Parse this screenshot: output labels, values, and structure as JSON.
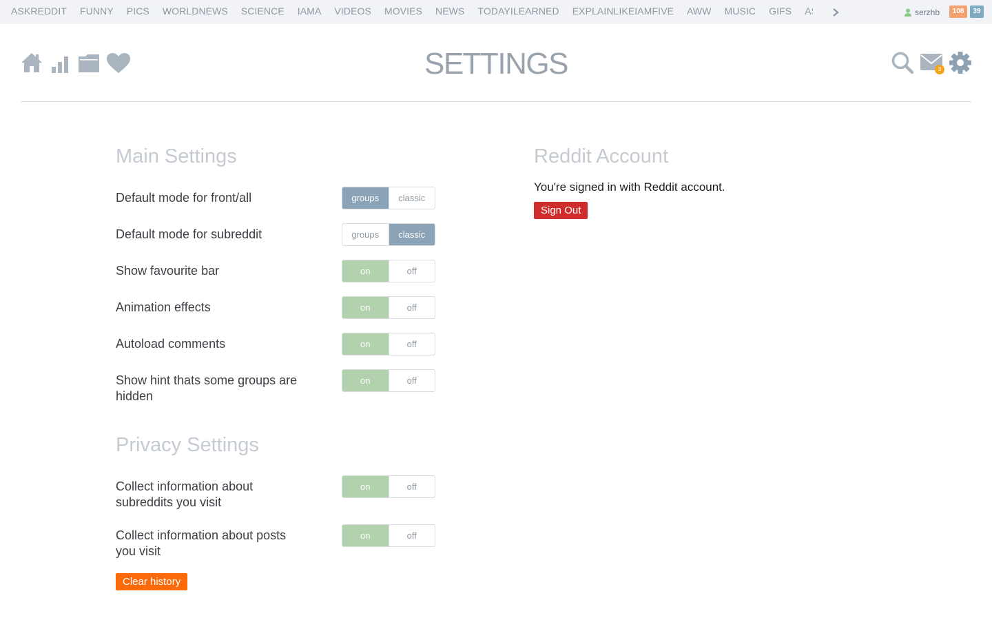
{
  "topbar": {
    "subreddits": [
      "ASKREDDIT",
      "FUNNY",
      "PICS",
      "WORLDNEWS",
      "SCIENCE",
      "IAMA",
      "VIDEOS",
      "MOVIES",
      "NEWS",
      "TODAYILEARNED",
      "EXPLAINLIKEIAMFIVE",
      "AWW",
      "MUSIC",
      "GIFS",
      "ASKSCIENCE"
    ],
    "username": "serzhb",
    "karma": "108",
    "comment_karma": "39"
  },
  "header": {
    "title": "SETTINGS",
    "mail_count": "3",
    "icons": [
      "home-icon",
      "stats-icon",
      "folder-icon",
      "heart-icon",
      "search-icon",
      "mail-icon",
      "gear-icon"
    ]
  },
  "main_settings": {
    "title": "Main Settings",
    "rows": [
      {
        "label": "Default mode for front/all",
        "options": [
          "groups",
          "classic"
        ],
        "selected": 0,
        "style": "blue"
      },
      {
        "label": "Default mode for subreddit",
        "options": [
          "groups",
          "classic"
        ],
        "selected": 1,
        "style": "blue"
      },
      {
        "label": "Show favourite bar",
        "options": [
          "on",
          "off"
        ],
        "selected": 0,
        "style": "green"
      },
      {
        "label": "Animation effects",
        "options": [
          "on",
          "off"
        ],
        "selected": 0,
        "style": "green"
      },
      {
        "label": "Autoload comments",
        "options": [
          "on",
          "off"
        ],
        "selected": 0,
        "style": "green"
      },
      {
        "label": "Show hint thats some groups are hidden",
        "options": [
          "on",
          "off"
        ],
        "selected": 0,
        "style": "green"
      }
    ]
  },
  "privacy_settings": {
    "title": "Privacy Settings",
    "rows": [
      {
        "label": "Collect information about subreddits you visit",
        "options": [
          "on",
          "off"
        ],
        "selected": 0,
        "style": "green"
      },
      {
        "label": "Collect information about posts you visit",
        "options": [
          "on",
          "off"
        ],
        "selected": 0,
        "style": "green"
      }
    ],
    "clear_label": "Clear history"
  },
  "account": {
    "title": "Reddit Account",
    "status_text": "You're signed in with Reddit account.",
    "signout_label": "Sign Out"
  },
  "colors": {
    "selected_blue": "#8ba3b7",
    "selected_green": "#b2d1ad",
    "clear_button": "#fa6a0a",
    "signout_button": "#cf2c2c",
    "icon_gray": "#aab4be"
  }
}
